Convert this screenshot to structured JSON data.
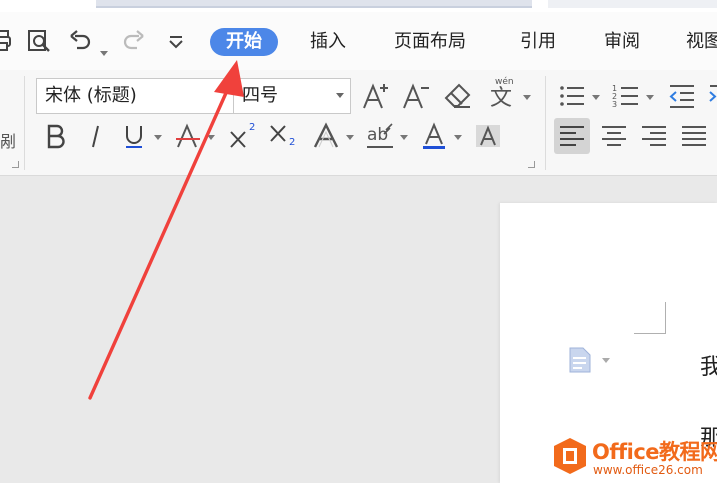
{
  "menubar": {
    "tabs": [
      {
        "label": "开始",
        "active": true
      },
      {
        "label": "插入"
      },
      {
        "label": "页面布局"
      },
      {
        "label": "引用"
      },
      {
        "label": "审阅"
      },
      {
        "label": "视图"
      }
    ]
  },
  "ribbon": {
    "font_name": "宋体 (标题)",
    "font_size": "四号",
    "group_edge_label": "剐",
    "phonetic_hint": "wén",
    "phonetic_char": "文",
    "superscript_digit": "2",
    "subscript_digit": "2"
  },
  "document": {
    "line1_char": "我",
    "line2_char": "那"
  },
  "watermark": {
    "title": "Office教程网",
    "url": "www.office26.com"
  },
  "colors": {
    "active_tab": "#4c87e8",
    "arrow": "#f0413c",
    "underline_color": "#1f4fd6",
    "watermark_orange": "#f26a1b"
  }
}
